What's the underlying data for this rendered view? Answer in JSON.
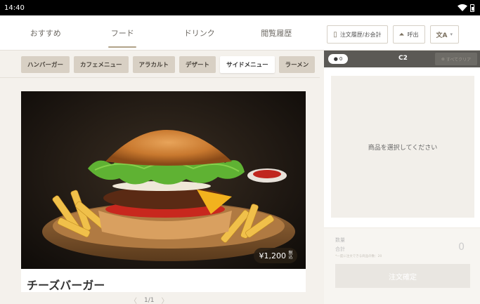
{
  "status_bar": {
    "time": "14:40",
    "wifi_icon": "wifi-icon",
    "battery_icon": "battery-icon"
  },
  "main_tabs": [
    {
      "label": "おすすめ"
    },
    {
      "label": "フード",
      "active": true
    },
    {
      "label": "ドリンク"
    },
    {
      "label": "閲覧履歴"
    }
  ],
  "top_actions": {
    "history_label": "注文履歴/お会計",
    "call_label": "呼出",
    "language_icon": "translate-icon",
    "language_dropdown_icon": "chevron-down-icon"
  },
  "categories": [
    {
      "label": "ハンバーガー"
    },
    {
      "label": "カフェメニュー"
    },
    {
      "label": "アラカルト"
    },
    {
      "label": "デザート"
    },
    {
      "label": "サイドメニュー",
      "active": true
    },
    {
      "label": "ラーメン"
    }
  ],
  "product": {
    "name": "チーズバーガー",
    "price": "¥1,200",
    "tax_label": "税込"
  },
  "pager": {
    "current": "1",
    "total": "1",
    "separator": "/"
  },
  "order_panel": {
    "guest_count": "0",
    "table_code": "C2",
    "clear_label": "すべてクリア",
    "empty_message": "商品を選択してください",
    "quantity_label": "数量",
    "total_label": "合計",
    "note": "*一度に注文できる商品の数：20",
    "total_value": "0",
    "confirm_label": "注文確定"
  },
  "colors": {
    "accent": "#b0a288",
    "chip_bg": "#d8d0c4",
    "panel_header": "#5b5955",
    "page_bg": "#f4f1ec"
  }
}
